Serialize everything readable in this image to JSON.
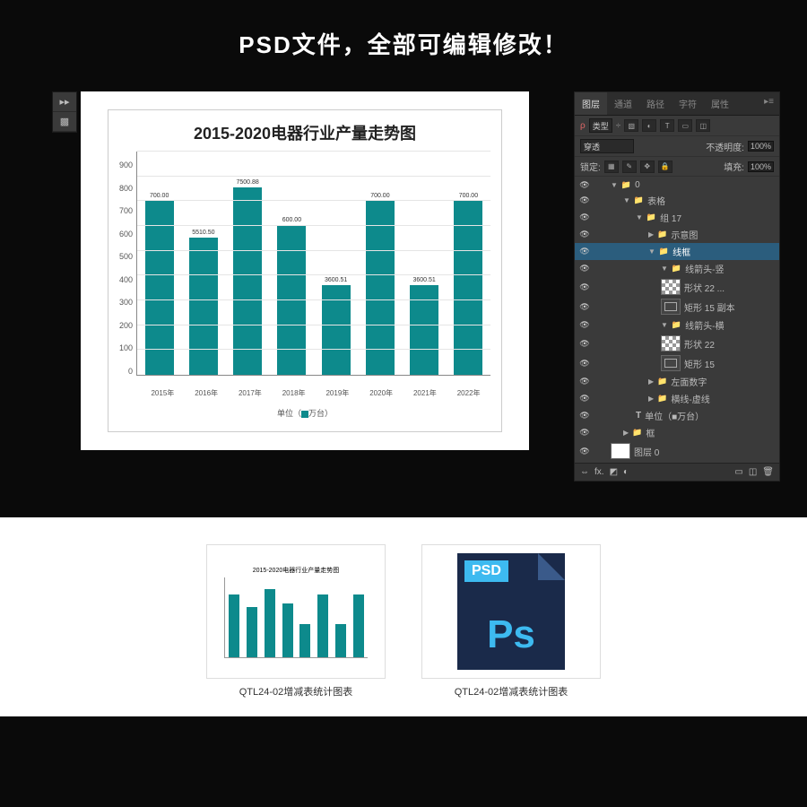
{
  "banner": "PSD文件，全部可编辑修改！",
  "chart_data": {
    "type": "bar",
    "title": "2015-2020电器行业产量走势图",
    "categories": [
      "2015年",
      "2016年",
      "2017年",
      "2018年",
      "2019年",
      "2020年",
      "2021年",
      "2022年"
    ],
    "values": [
      700.0,
      551.5,
      750.88,
      600.0,
      360.51,
      700.0,
      360.51,
      700.0
    ],
    "data_labels": [
      "700.00",
      "5510.50",
      "7500.88",
      "600.00",
      "3600.51",
      "700.00",
      "3600.51",
      "700.00"
    ],
    "ylabel": "",
    "xlabel": "",
    "ylim": [
      0,
      900
    ],
    "y_ticks": [
      0,
      100,
      200,
      300,
      400,
      500,
      600,
      700,
      800,
      900
    ],
    "legend_text": "单位（",
    "legend_unit": "万台）"
  },
  "panel": {
    "tabs": [
      "图层",
      "通道",
      "路径",
      "字符",
      "属性"
    ],
    "type_filter": "类型",
    "blend_mode": "穿透",
    "opacity_label": "不透明度:",
    "opacity_value": "100%",
    "lock_label": "锁定:",
    "fill_label": "填充:",
    "fill_value": "100%",
    "tree": [
      {
        "level": 1,
        "caret": "▼",
        "kind": "folder",
        "name": "0"
      },
      {
        "level": 2,
        "caret": "▼",
        "kind": "folder",
        "name": "表格"
      },
      {
        "level": 3,
        "caret": "▼",
        "kind": "folder",
        "name": "组 17"
      },
      {
        "level": 4,
        "caret": "▶",
        "kind": "folder",
        "name": "示意图"
      },
      {
        "level": 4,
        "caret": "▼",
        "kind": "folder",
        "name": "线框",
        "selected": true
      },
      {
        "level": 5,
        "caret": "▼",
        "kind": "folder",
        "name": "线箭头-竖"
      },
      {
        "level": 5,
        "caret": "",
        "kind": "checker",
        "name": "形状 22 ..."
      },
      {
        "level": 5,
        "caret": "",
        "kind": "shape",
        "name": "矩形 15 副本"
      },
      {
        "level": 5,
        "caret": "▼",
        "kind": "folder",
        "name": "线箭头-横"
      },
      {
        "level": 5,
        "caret": "",
        "kind": "checker",
        "name": "形状 22"
      },
      {
        "level": 5,
        "caret": "",
        "kind": "shape",
        "name": "矩形 15"
      },
      {
        "level": 4,
        "caret": "▶",
        "kind": "folder",
        "name": "左面数字"
      },
      {
        "level": 4,
        "caret": "▶",
        "kind": "folder",
        "name": "横线-虚线"
      },
      {
        "level": 3,
        "caret": "",
        "kind": "text",
        "name": "单位（■万台）"
      },
      {
        "level": 2,
        "caret": "▶",
        "kind": "folder",
        "name": "框"
      },
      {
        "level": 1,
        "caret": "",
        "kind": "white",
        "name": "图层 0"
      }
    ]
  },
  "thumbs": {
    "file1": "QTL24-02增减表统计图表",
    "file2": "QTL24-02增减表统计图表",
    "psd_badge": "PSD",
    "psd_ps": "Ps"
  }
}
